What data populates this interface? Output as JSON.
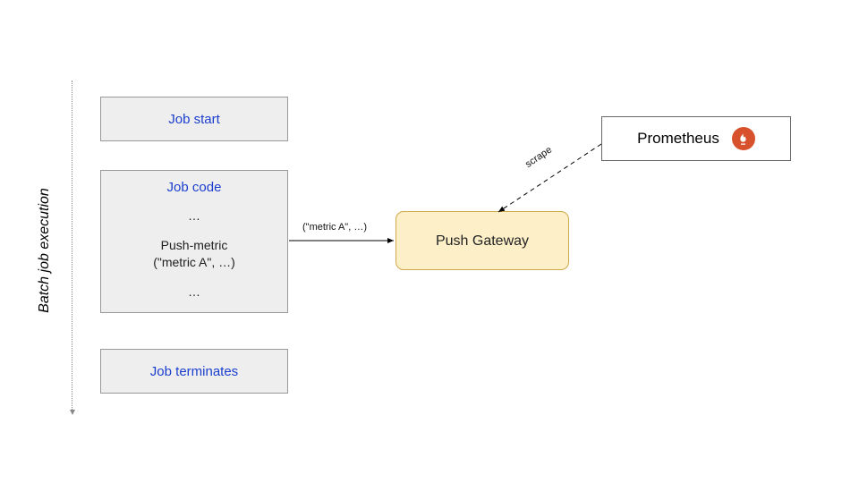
{
  "axis_label": "Batch job execution",
  "job_start": {
    "title": "Job start"
  },
  "job_code": {
    "title": "Job code",
    "ellipsis": "…",
    "push_line1": "Push-metric",
    "push_line2": "(\"metric A\", …)"
  },
  "job_terminates": {
    "title": "Job terminates"
  },
  "push_gateway": {
    "label": "Push Gateway"
  },
  "prometheus": {
    "label": "Prometheus"
  },
  "edge_push_label": "(\"metric A\", …)",
  "edge_scrape_label": "scrape",
  "colors": {
    "job_bg": "#eeeeee",
    "gateway_bg": "#fdf0c9",
    "prometheus_icon": "#d7522c",
    "title_text": "#1b3ecf"
  }
}
